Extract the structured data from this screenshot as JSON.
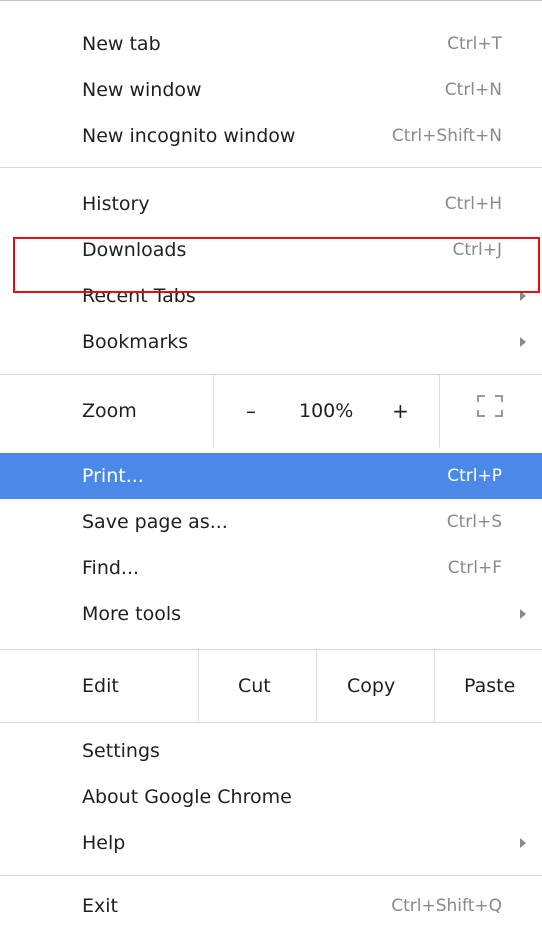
{
  "menu": {
    "new_tab": {
      "label": "New tab",
      "shortcut": "Ctrl+T"
    },
    "new_window": {
      "label": "New window",
      "shortcut": "Ctrl+N"
    },
    "new_incognito": {
      "label": "New incognito window",
      "shortcut": "Ctrl+Shift+N"
    },
    "history": {
      "label": "History",
      "shortcut": "Ctrl+H"
    },
    "downloads": {
      "label": "Downloads",
      "shortcut": "Ctrl+J"
    },
    "recent_tabs": {
      "label": "Recent Tabs"
    },
    "bookmarks": {
      "label": "Bookmarks"
    },
    "zoom": {
      "label": "Zoom",
      "minus": "–",
      "value": "100%",
      "plus": "+",
      "fullscreen_icon": "fullscreen-icon"
    },
    "print": {
      "label": "Print...",
      "shortcut": "Ctrl+P"
    },
    "save_page": {
      "label": "Save page as...",
      "shortcut": "Ctrl+S"
    },
    "find": {
      "label": "Find...",
      "shortcut": "Ctrl+F"
    },
    "more_tools": {
      "label": "More tools"
    },
    "edit": {
      "label": "Edit",
      "cut": "Cut",
      "copy": "Copy",
      "paste": "Paste"
    },
    "settings": {
      "label": "Settings"
    },
    "about": {
      "label": "About Google Chrome"
    },
    "help": {
      "label": "Help"
    },
    "exit": {
      "label": "Exit",
      "shortcut": "Ctrl+Shift+Q"
    }
  },
  "colors": {
    "highlight": "#4a89e8",
    "annotation_box": "#e01010",
    "shortcut_text": "#8a8a8a"
  }
}
